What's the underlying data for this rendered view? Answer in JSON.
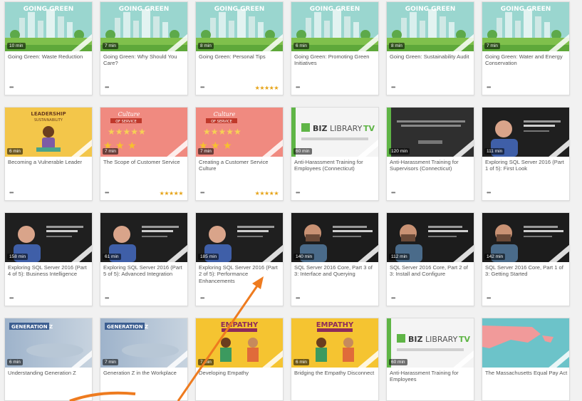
{
  "colors": {
    "arrow": "#ee7b1f",
    "stars": "#e6a317",
    "green_sky": "#8ed0c8",
    "green_grass": "#8bc34a"
  },
  "rows": [
    [
      {
        "theme": "green",
        "duration": "10 min",
        "title": "Going Green: Waste Reduction",
        "banner": "GOING GREEN",
        "stars": ""
      },
      {
        "theme": "green",
        "duration": "7 min",
        "title": "Going Green: Why Should You Care?",
        "banner": "GOING GREEN",
        "stars": ""
      },
      {
        "theme": "green",
        "duration": "8 min",
        "title": "Going Green: Personal Tips",
        "banner": "GOING GREEN",
        "stars": "★★★★★"
      },
      {
        "theme": "green",
        "duration": "6 min",
        "title": "Going Green: Promoting Green Initiatives",
        "banner": "GOING GREEN",
        "stars": ""
      },
      {
        "theme": "green",
        "duration": "8 min",
        "title": "Going Green: Sustainability Audit",
        "banner": "GOING GREEN",
        "stars": ""
      },
      {
        "theme": "green",
        "duration": "7 min",
        "title": "Going Green: Water and Energy Conservation",
        "banner": "GOING GREEN",
        "stars": ""
      }
    ],
    [
      {
        "theme": "leader",
        "duration": "6 min",
        "title": "Becoming a Vulnerable Leader",
        "banner": "LEADERSHIP",
        "stars": ""
      },
      {
        "theme": "service",
        "duration": "7 min",
        "title": "The Scope of Customer Service",
        "banner": "Culture",
        "stars": "★★★★★"
      },
      {
        "theme": "service",
        "duration": "7 min",
        "title": "Creating a Customer Service Culture",
        "banner": "Culture",
        "stars": "★★★★★"
      },
      {
        "theme": "biztv",
        "duration": "60 min",
        "title": "Anti-Harassment Training for Employees (Connecticut)",
        "banner": "BIZLIBRARYTV",
        "stars": ""
      },
      {
        "theme": "supervisor",
        "duration": "120 min",
        "title": "Anti-Harassment Training for Supervisors (Connecticut)",
        "banner": "",
        "stars": ""
      },
      {
        "theme": "sql",
        "duration": "111 min",
        "title": "Exploring SQL Server 2016 (Part 1 of 5): First Look",
        "banner": "",
        "stars": ""
      }
    ],
    [
      {
        "theme": "sql",
        "duration": "158 min",
        "title": "Exploring SQL Server 2016 (Part 4 of 5): Business Intelligence",
        "banner": "",
        "stars": ""
      },
      {
        "theme": "sql",
        "duration": "61 min",
        "title": "Exploring SQL Server 2016 (Part 5 of 5): Advanced Integration",
        "banner": "",
        "stars": ""
      },
      {
        "theme": "sql",
        "duration": "185 min",
        "title": "Exploring SQL Server 2016 (Part 2 of 5): Performance Enhancements",
        "banner": "",
        "stars": ""
      },
      {
        "theme": "sqlcore",
        "duration": "140 min",
        "title": "SQL Server 2016 Core, Part 3 of 3: Interface and Querying",
        "banner": "",
        "stars": ""
      },
      {
        "theme": "sqlcore",
        "duration": "112 min",
        "title": "SQL Server 2016 Core, Part 2 of 3: Install and Configure",
        "banner": "",
        "stars": ""
      },
      {
        "theme": "sqlcore",
        "duration": "142 min",
        "title": "SQL Server 2016 Core, Part 1 of 3: Getting Started",
        "banner": "",
        "stars": ""
      }
    ],
    [
      {
        "theme": "genz",
        "duration": "6 min",
        "title": "Understanding Generation Z",
        "banner": "GENERATION Z",
        "stars": ""
      },
      {
        "theme": "genz",
        "duration": "7 min",
        "title": "Generation Z in the Workplace",
        "banner": "GENERATION Z",
        "stars": ""
      },
      {
        "theme": "empathy",
        "duration": "7 min",
        "title": "Developing Empathy",
        "banner": "EMPATHY",
        "stars": ""
      },
      {
        "theme": "empathy",
        "duration": "6 min",
        "title": "Bridging the Empathy Disconnect",
        "banner": "EMPATHY",
        "stars": ""
      },
      {
        "theme": "biztv",
        "duration": "60 min",
        "title": "Anti-Harassment Training for Employees",
        "banner": "BIZLIBRARYTV",
        "stars": ""
      },
      {
        "theme": "map",
        "duration": "",
        "title": "The Massachusetts Equal Pay Act",
        "banner": "",
        "stars": ""
      }
    ]
  ],
  "more_label": "•••"
}
